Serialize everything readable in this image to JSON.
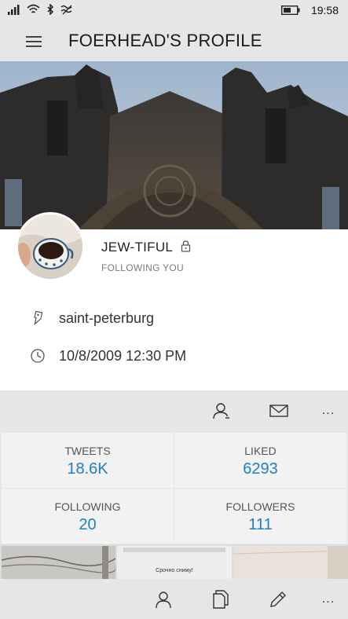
{
  "status_bar": {
    "time": "19:58",
    "icons": [
      "signal-icon",
      "wifi-icon",
      "bluetooth-icon",
      "data-sense-icon",
      "battery-icon"
    ]
  },
  "header": {
    "title": "FOERHEAD'S PROFILE",
    "menu_icon": "hamburger-icon"
  },
  "profile": {
    "banner_image": "cathedral-photo",
    "avatar_image": "coffee-cup-photo",
    "display_name": "JEW-TIFUL",
    "protected_icon": "lock-icon",
    "follow_status": "FOLLOWING YOU",
    "location": "saint-peterburg",
    "joined": "10/8/2009 12:30 PM"
  },
  "actions": {
    "icons": [
      "user-icon",
      "mail-icon",
      "more-icon"
    ],
    "more_glyph": "..."
  },
  "stats": [
    {
      "label": "TWEETS",
      "value": "18.6K"
    },
    {
      "label": "LIKED",
      "value": "6293"
    },
    {
      "label": "FOLLOWING",
      "value": "20"
    },
    {
      "label": "FOLLOWERS",
      "value": "111"
    }
  ],
  "media": {
    "thumb_caption": "Срочно сниму!"
  },
  "bottom_bar": {
    "icons": [
      "profile-icon",
      "copy-icon",
      "edit-icon",
      "more-icon"
    ],
    "more_glyph": "..."
  },
  "colors": {
    "accent": "#1f7fc1",
    "chrome": "#e6e6e6",
    "tile": "#f2f2f2"
  }
}
